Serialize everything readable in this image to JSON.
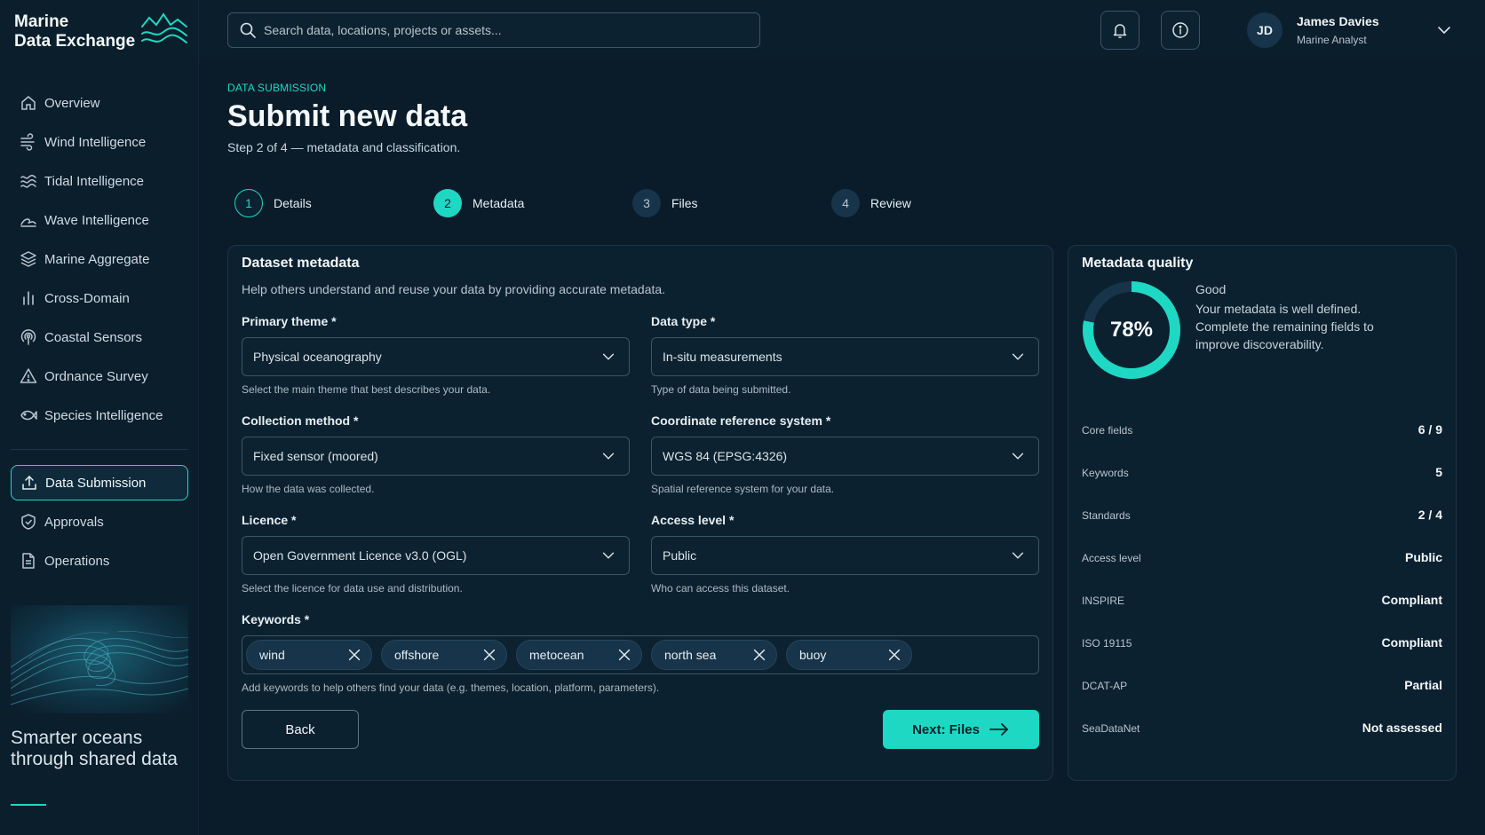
{
  "brand": {
    "line1": "Marine",
    "line2": "Data Exchange"
  },
  "sidebar": {
    "items": [
      {
        "label": "Overview",
        "icon": "home-icon"
      },
      {
        "label": "Wind Intelligence",
        "icon": "wind-icon"
      },
      {
        "label": "Tidal Intelligence",
        "icon": "tide-icon"
      },
      {
        "label": "Wave Intelligence",
        "icon": "wave-icon"
      },
      {
        "label": "Marine Aggregate",
        "icon": "layers-icon"
      },
      {
        "label": "Cross-Domain",
        "icon": "bar-chart-icon"
      },
      {
        "label": "Coastal Sensors",
        "icon": "sensor-icon"
      },
      {
        "label": "Ordnance Survey",
        "icon": "warning-icon"
      },
      {
        "label": "Species Intelligence",
        "icon": "fish-icon"
      }
    ],
    "secondary": [
      {
        "label": "Data Submission",
        "icon": "upload-icon",
        "active": true
      },
      {
        "label": "Approvals",
        "icon": "shield-check-icon"
      },
      {
        "label": "Operations",
        "icon": "document-icon"
      }
    ],
    "tagline": "Smarter oceans through shared data"
  },
  "topbar": {
    "search_placeholder": "Search data, locations, projects or assets...",
    "user": {
      "initials": "JD",
      "name": "James Davies",
      "role": "Marine Analyst"
    }
  },
  "page": {
    "eyebrow": "DATA SUBMISSION",
    "title": "Submit new data",
    "subtitle": "Step 2 of 4 — metadata and classification."
  },
  "steps": [
    {
      "num": "1",
      "label": "Details",
      "state": "done"
    },
    {
      "num": "2",
      "label": "Metadata",
      "state": "current"
    },
    {
      "num": "3",
      "label": "Files",
      "state": "todo"
    },
    {
      "num": "4",
      "label": "Review",
      "state": "todo"
    }
  ],
  "form": {
    "title": "Dataset metadata",
    "description": "Help others understand and reuse your data by providing accurate metadata.",
    "primary_theme": {
      "label": "Primary theme *",
      "value": "Physical oceanography",
      "help": "Select the main theme that best describes your data."
    },
    "data_type": {
      "label": "Data type *",
      "value": "In-situ measurements",
      "help": "Type of data being submitted."
    },
    "collection_method": {
      "label": "Collection method *",
      "value": "Fixed sensor (moored)",
      "help": "How the data was collected."
    },
    "crs": {
      "label": "Coordinate reference system *",
      "value": "WGS 84 (EPSG:4326)",
      "help": "Spatial reference system for your data."
    },
    "licence": {
      "label": "Licence *",
      "value": "Open Government Licence v3.0 (OGL)",
      "help": "Select the licence for data use and distribution."
    },
    "access_level": {
      "label": "Access level *",
      "value": "Public",
      "help": "Who can access this dataset."
    },
    "keywords": {
      "label": "Keywords *",
      "items": [
        "wind",
        "offshore",
        "metocean",
        "north sea",
        "buoy"
      ],
      "help": "Add keywords to help others find your data (e.g. themes, location, platform, parameters)."
    },
    "back_label": "Back",
    "next_label": "Next: Files"
  },
  "quality": {
    "title": "Metadata quality",
    "score": 78,
    "score_label": "78%",
    "status": "Good",
    "message": "Your metadata is well defined. Complete the remaining fields to improve discoverability.",
    "metrics": [
      {
        "label": "Core fields",
        "value": "6 / 9"
      },
      {
        "label": "Keywords",
        "value": "5"
      },
      {
        "label": "Standards",
        "value": "2 / 4"
      },
      {
        "label": "Access level",
        "value": "Public"
      },
      {
        "label": "INSPIRE",
        "value": "Compliant"
      },
      {
        "label": "ISO 19115",
        "value": "Compliant"
      },
      {
        "label": "DCAT-AP",
        "value": "Partial"
      },
      {
        "label": "SeaDataNet",
        "value": "Not assessed"
      }
    ]
  },
  "colors": {
    "accent": "#1ed8c4",
    "background": "#0a1c2a",
    "card": "#0c2130"
  }
}
